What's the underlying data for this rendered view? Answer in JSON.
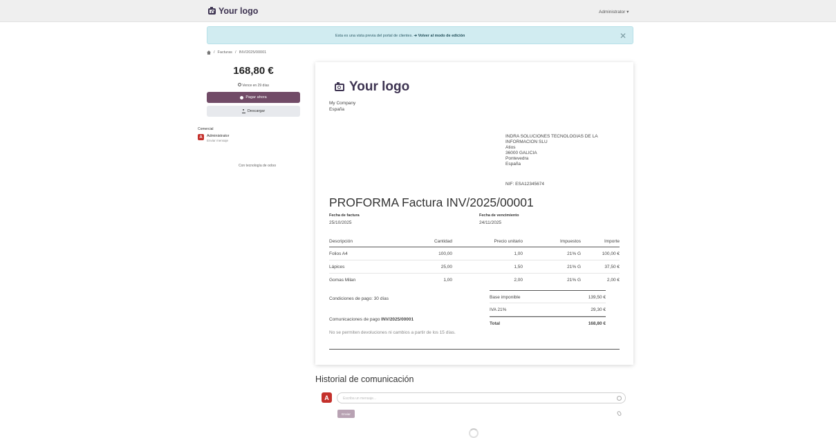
{
  "topbar": {
    "logo_text": "Your logo",
    "user_menu": "Administrator ▾"
  },
  "alert": {
    "text": "Esta es una vista previa del portal de clientes. ",
    "link": "➔ Volver al modo de edición",
    "close": "✕"
  },
  "breadcrumb": {
    "items": [
      "Facturas",
      "INV/2025/00001"
    ],
    "separator": "/"
  },
  "sidebar": {
    "amount": "168,80 €",
    "due": "Vence en 29 días",
    "pay_button": "Pagar ahora",
    "download_button": "Descargar",
    "salesperson_label": "Comercial",
    "salesperson_initial": "A",
    "salesperson_name": "Administrator",
    "salesperson_action": "Enviar mensaje",
    "powered_prefix": "Con tecnología de",
    "powered_brand": "odoo"
  },
  "invoice": {
    "logo_text": "Your logo",
    "company_lines": [
      "My Company",
      "España"
    ],
    "partner_lines": [
      "INDRA SOLUCIONES TECNOLOGIAS DE LA",
      "INFORMACION SLU",
      "Atios",
      "36000 GALICIA",
      "Pontevedra",
      "España"
    ],
    "vat": "NIF: ESA12345674",
    "title": "PROFORMA Factura INV/2025/00001",
    "invoice_date_label": "Fecha de factura",
    "invoice_date": "25/10/2025",
    "due_date_label": "Fecha de vencimiento",
    "due_date": "24/11/2025",
    "columns": [
      "Descripción",
      "Cantidad",
      "Precio unitario",
      "Impuestos",
      "Importe"
    ],
    "lines": [
      {
        "desc": "Folios A4",
        "qty": "100,00",
        "price": "1,00",
        "tax": "21% G",
        "amount": "100,00 €"
      },
      {
        "desc": "Lápices",
        "qty": "25,00",
        "price": "1,50",
        "tax": "21% G",
        "amount": "37,50 €"
      },
      {
        "desc": "Gomas Milan",
        "qty": "1,00",
        "price": "2,00",
        "tax": "21% G",
        "amount": "2,00 €"
      }
    ],
    "totals": [
      {
        "label": "Base imponible",
        "value": "139,50 €"
      },
      {
        "label": "IVA 21%",
        "value": "29,30 €"
      },
      {
        "label": "Total",
        "value": "168,80 €"
      }
    ],
    "payment_terms": "Condiciones de pago: 30 días",
    "payment_comm_prefix": "Comunicaciones de pago ",
    "payment_comm_ref": "INV/2025/00001",
    "note": "No se permiten devoluciones ni cambios a partir de los 15 días."
  },
  "chatter": {
    "title": "Historial de comunicación",
    "avatar_initial": "A",
    "placeholder": "Escriba un mensaje...",
    "send_button": "Enviar"
  }
}
